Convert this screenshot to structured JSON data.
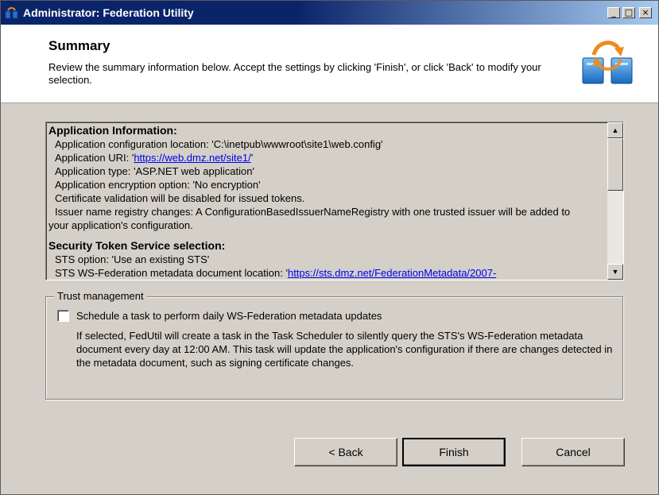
{
  "window": {
    "title": "Administrator: Federation Utility",
    "controls": {
      "minimize": "_",
      "maximize": "□",
      "close": "×"
    }
  },
  "header": {
    "title": "Summary",
    "description": "Review the summary information below. Accept the settings by clicking 'Finish', or click 'Back' to modify your selection."
  },
  "summary": {
    "app_info": {
      "heading": "Application Information:",
      "config_location": "Application configuration location: 'C:\\inetpub\\wwwroot\\site1\\web.config'",
      "uri_prefix": "Application URI: '",
      "uri_link": "https://web.dmz.net/site1/",
      "uri_suffix": "'",
      "app_type": "Application type: 'ASP.NET web application'",
      "encryption": "Application encryption option: 'No encryption'",
      "cert_validation": "Certificate validation will be disabled for issued tokens.",
      "issuer_line1": "Issuer name registry changes: A ConfigurationBasedIssuerNameRegistry with one trusted issuer will be added to",
      "issuer_line2": "your application's configuration."
    },
    "sts": {
      "heading": "Security Token Service selection:",
      "option": "STS option: 'Use an existing STS'",
      "metadata_prefix": "STS WS-Federation metadata document location: '",
      "metadata_link": "https://sts.dmz.net/FederationMetadata/2007-"
    }
  },
  "trust": {
    "legend": "Trust management",
    "checkbox_label": "Schedule a task to perform daily WS-Federation metadata updates",
    "checked": false,
    "description": "If selected, FedUtil will create a task in the Task Scheduler to silently query the STS's WS-Federation metadata document every day at 12:00 AM.  This task will update the application's configuration if there are changes detected in the metadata document, such as signing certificate changes."
  },
  "buttons": {
    "back": "< Back",
    "finish": "Finish",
    "cancel": "Cancel"
  },
  "scrollbar": {
    "up": "▲",
    "down": "▼"
  }
}
